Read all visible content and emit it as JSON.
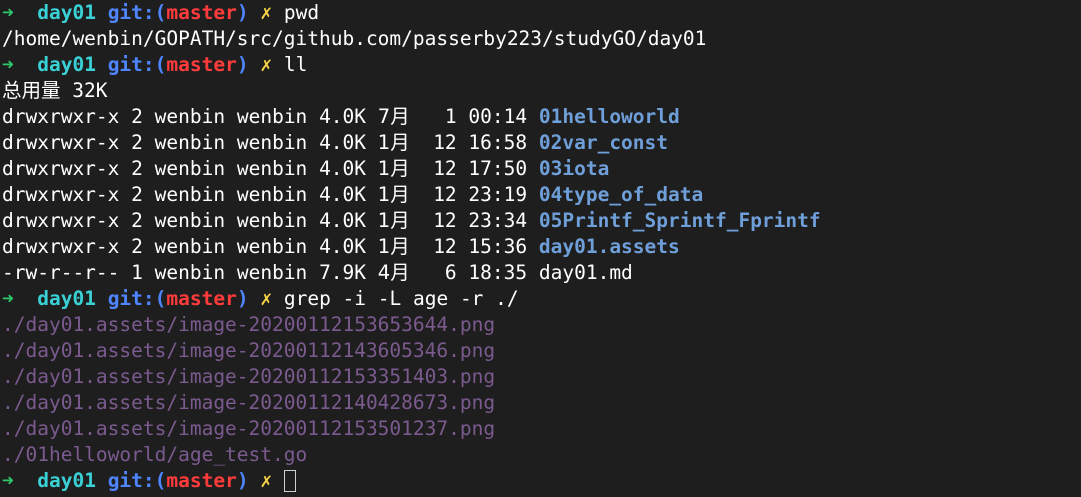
{
  "prompt": {
    "arrow": "➜",
    "dir": "day01",
    "git_open": "git:(",
    "branch": "master",
    "git_close": ")",
    "dirty": "✗"
  },
  "lines": [
    {
      "type": "prompt",
      "cmd": "pwd"
    },
    {
      "type": "out",
      "text": "/home/wenbin/GOPATH/src/github.com/passerby223/studyGO/day01"
    },
    {
      "type": "prompt",
      "cmd": "ll"
    },
    {
      "type": "out",
      "text": "总用量 32K"
    },
    {
      "type": "ls",
      "perm": "drwxrwxr-x",
      "links": "2",
      "user": "wenbin",
      "group": "wenbin",
      "size": "4.0K",
      "month": "7月",
      "day": " 1",
      "time": "00:14",
      "name": "01helloworld",
      "kind": "dir"
    },
    {
      "type": "ls",
      "perm": "drwxrwxr-x",
      "links": "2",
      "user": "wenbin",
      "group": "wenbin",
      "size": "4.0K",
      "month": "1月",
      "day": "12",
      "time": "16:58",
      "name": "02var_const",
      "kind": "dir"
    },
    {
      "type": "ls",
      "perm": "drwxrwxr-x",
      "links": "2",
      "user": "wenbin",
      "group": "wenbin",
      "size": "4.0K",
      "month": "1月",
      "day": "12",
      "time": "17:50",
      "name": "03iota",
      "kind": "dir"
    },
    {
      "type": "ls",
      "perm": "drwxrwxr-x",
      "links": "2",
      "user": "wenbin",
      "group": "wenbin",
      "size": "4.0K",
      "month": "1月",
      "day": "12",
      "time": "23:19",
      "name": "04type_of_data",
      "kind": "dir"
    },
    {
      "type": "ls",
      "perm": "drwxrwxr-x",
      "links": "2",
      "user": "wenbin",
      "group": "wenbin",
      "size": "4.0K",
      "month": "1月",
      "day": "12",
      "time": "23:34",
      "name": "05Printf_Sprintf_Fprintf",
      "kind": "dir"
    },
    {
      "type": "ls",
      "perm": "drwxrwxr-x",
      "links": "2",
      "user": "wenbin",
      "group": "wenbin",
      "size": "4.0K",
      "month": "1月",
      "day": "12",
      "time": "15:36",
      "name": "day01.assets",
      "kind": "dir"
    },
    {
      "type": "ls",
      "perm": "-rw-r--r--",
      "links": "1",
      "user": "wenbin",
      "group": "wenbin",
      "size": "7.9K",
      "month": "4月",
      "day": " 6",
      "time": "18:35",
      "name": "day01.md",
      "kind": "file"
    },
    {
      "type": "prompt",
      "cmd": "grep -i -L age -r ./"
    },
    {
      "type": "match",
      "text": "./day01.assets/image-20200112153653644.png"
    },
    {
      "type": "match",
      "text": "./day01.assets/image-20200112143605346.png"
    },
    {
      "type": "match",
      "text": "./day01.assets/image-20200112153351403.png"
    },
    {
      "type": "match",
      "text": "./day01.assets/image-20200112140428673.png"
    },
    {
      "type": "match",
      "text": "./day01.assets/image-20200112153501237.png"
    },
    {
      "type": "match",
      "text": "./01helloworld/age_test.go"
    },
    {
      "type": "prompt",
      "cmd": "",
      "cursor": true
    }
  ],
  "colors": {
    "background": "#1e1e1e",
    "arrow": "#2dc86b",
    "dir": "#3ad1d6",
    "git": "#4f86ff",
    "branch": "#ff3b3b",
    "dirty": "#f7d547",
    "ls_dir": "#6f9fd9",
    "grep_match": "#7b5a8f"
  }
}
